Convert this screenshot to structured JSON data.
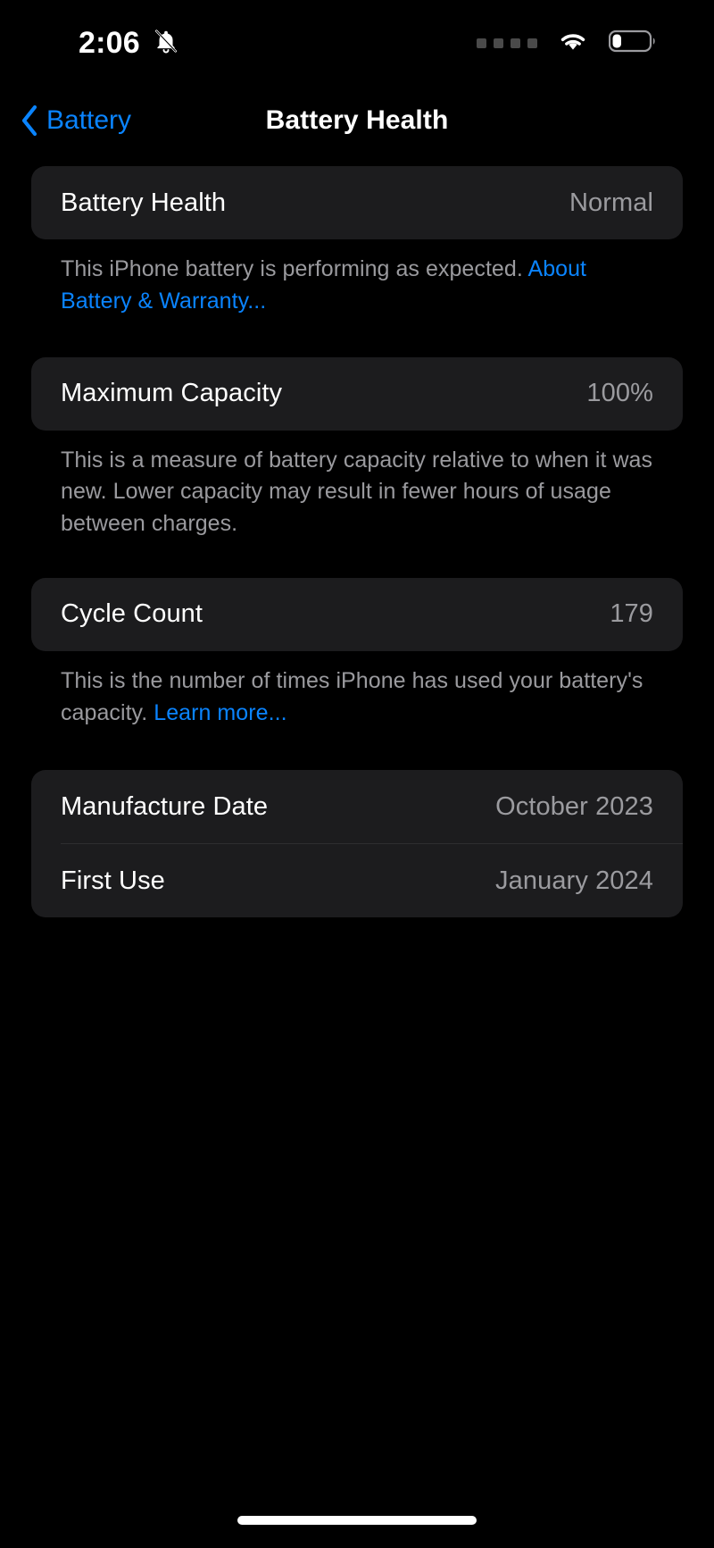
{
  "status_bar": {
    "time": "2:06",
    "silent_mode_icon": "bell-slash-icon",
    "cellular_icon": "cellular-dots-icon",
    "cellular_dots": 4,
    "wifi_icon": "wifi-icon",
    "battery_icon": "battery-low-icon",
    "battery_level_percent": 20
  },
  "nav": {
    "back_label": "Battery",
    "back_icon": "chevron-left-icon",
    "title": "Battery Health"
  },
  "sections": [
    {
      "rows": [
        {
          "label": "Battery Health",
          "value": "Normal"
        }
      ],
      "footer": {
        "text": "This iPhone battery is performing as expected. ",
        "link": "About Battery & Warranty..."
      }
    },
    {
      "rows": [
        {
          "label": "Maximum Capacity",
          "value": "100%"
        }
      ],
      "footer": {
        "text": "This is a measure of battery capacity relative to when it was new. Lower capacity may result in fewer hours of usage between charges.",
        "link": ""
      }
    },
    {
      "rows": [
        {
          "label": "Cycle Count",
          "value": "179"
        }
      ],
      "footer": {
        "text": "This is the number of times iPhone has used your battery's capacity. ",
        "link": "Learn more..."
      }
    },
    {
      "rows": [
        {
          "label": "Manufacture Date",
          "value": "October 2023"
        },
        {
          "label": "First Use",
          "value": "January 2024"
        }
      ],
      "footer": {
        "text": "",
        "link": ""
      }
    }
  ],
  "home_indicator": "home-indicator",
  "colors": {
    "background": "#000000",
    "card": "#1c1c1e",
    "accent_blue": "#0a84ff",
    "primary_text": "#ffffff",
    "secondary_text": "#9b9b9f"
  }
}
